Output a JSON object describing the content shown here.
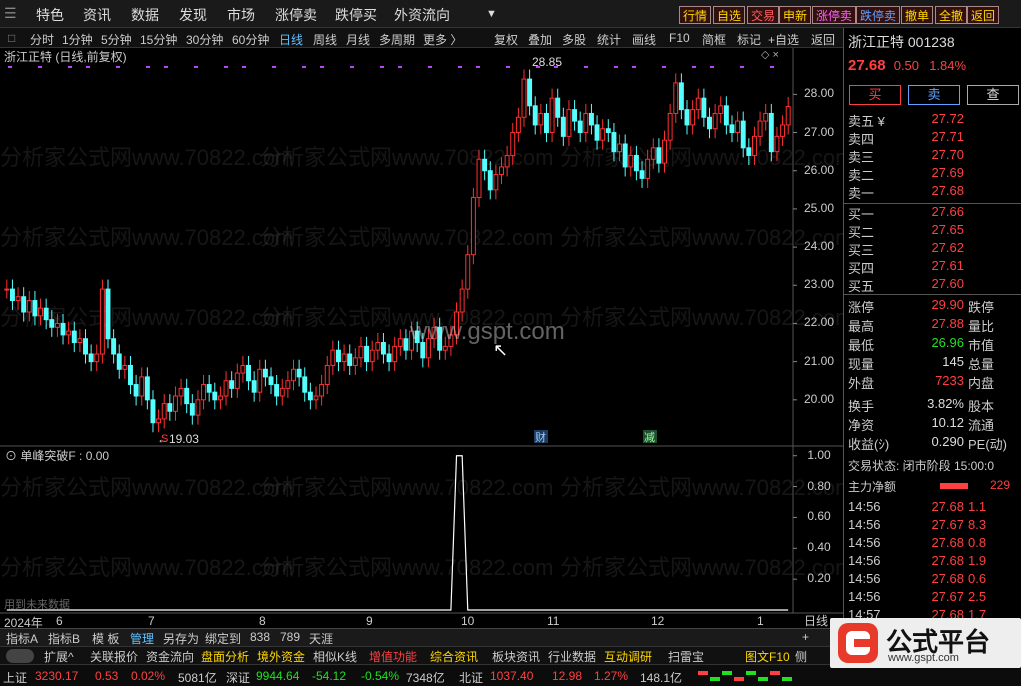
{
  "menubar": {
    "items": [
      "特色",
      "资讯",
      "数据",
      "发现",
      "市场",
      "涨停卖",
      "跌停买",
      "外资流向"
    ],
    "quick": [
      {
        "label": "行情",
        "color": "#ffd700"
      },
      {
        "label": "自选",
        "color": "#ffd700"
      },
      {
        "label": "交易",
        "color": "#ff6060"
      },
      {
        "label": "申新",
        "color": "#ffd700"
      },
      {
        "label": "涨停卖",
        "color": "#ff60ff"
      },
      {
        "label": "跌停卖",
        "color": "#60a0ff"
      },
      {
        "label": "撤单",
        "color": "#ffd700"
      },
      {
        "label": "全撤",
        "color": "#ffd700"
      },
      {
        "label": "返回",
        "color": "#ffd700"
      }
    ]
  },
  "periods": [
    "分时",
    "1分钟",
    "5分钟",
    "15分钟",
    "30分钟",
    "60分钟",
    "日线",
    "周线",
    "月线",
    "多周期",
    "更多 〉"
  ],
  "active_period": "日线",
  "tools": [
    "复权",
    "叠加",
    "多股",
    "统计",
    "画线",
    "F10",
    "简框",
    "标记",
    "+自选",
    "返回"
  ],
  "chart_title": "浙江正特 (日线,前复权)",
  "subchart_title": "单峰突破F : 0.00",
  "subchart_note": "用到未来数据",
  "watermark": "分析家公式网www.70822.com",
  "center_watermark": "www.gspt.com",
  "chart_data": [
    {
      "type": "candlestick",
      "ylim": [
        19.0,
        28.9
      ],
      "yticks": [
        "28.00",
        "27.00",
        "26.00",
        "25.00",
        "24.00",
        "23.00",
        "22.00",
        "21.00",
        "20.00"
      ],
      "ytick_values": [
        28,
        27,
        26,
        25,
        24,
        23,
        22,
        21,
        20
      ],
      "xticks": [
        "2024年",
        "6",
        "7",
        "8",
        "9",
        "10",
        "11",
        "12",
        "1"
      ],
      "annotations": [
        {
          "text": "28.85",
          "value": 28.85
        },
        {
          "text": "19.03",
          "value": 19.03
        },
        {
          "text": "S"
        },
        {
          "text": "财"
        },
        {
          "text": "减"
        }
      ],
      "close": [
        22.9,
        22.6,
        22.7,
        22.3,
        22.6,
        22.2,
        22.4,
        22.1,
        21.9,
        22.0,
        21.7,
        21.8,
        21.5,
        21.6,
        21.2,
        21.0,
        21.2,
        22.9,
        21.6,
        21.2,
        20.8,
        20.9,
        20.4,
        20.1,
        20.6,
        20.0,
        19.4,
        19.5,
        19.9,
        19.7,
        20.1,
        20.3,
        19.9,
        19.6,
        20.0,
        20.4,
        20.2,
        20.0,
        20.1,
        20.5,
        20.3,
        20.7,
        20.9,
        20.5,
        20.2,
        20.8,
        20.6,
        20.4,
        20.1,
        20.3,
        20.5,
        20.8,
        20.6,
        20.2,
        20.0,
        20.1,
        20.4,
        20.9,
        21.3,
        21.0,
        21.2,
        20.9,
        21.1,
        21.4,
        21.0,
        21.3,
        21.5,
        21.2,
        21.0,
        21.4,
        21.6,
        21.3,
        21.8,
        21.5,
        21.1,
        21.6,
        21.9,
        21.3,
        21.4,
        21.7,
        22.3,
        22.9,
        23.8,
        25.3,
        26.3,
        26.0,
        25.5,
        25.9,
        26.1,
        26.4,
        27.0,
        27.4,
        28.4,
        27.7,
        27.2,
        27.5,
        27.0,
        27.9,
        27.4,
        26.9,
        27.6,
        27.3,
        27.0,
        27.5,
        27.2,
        26.8,
        27.1,
        27.0,
        26.5,
        26.7,
        26.1,
        26.4,
        26.0,
        25.8,
        26.3,
        26.6,
        26.2,
        26.8,
        27.5,
        28.3,
        27.6,
        27.2,
        27.6,
        27.9,
        27.4,
        27.1,
        27.5,
        27.7,
        27.2,
        27.0,
        27.3,
        26.6,
        26.4,
        26.9,
        27.3,
        27.5,
        26.5,
        26.9,
        27.2,
        27.68
      ],
      "indicator": {
        "name": "单峰突破F",
        "yticks": [
          "1.00",
          "0.80",
          "0.60",
          "0.40",
          "0.20"
        ],
        "ytick_values": [
          1,
          0.8,
          0.6,
          0.4,
          0.2
        ],
        "ylim": [
          0,
          1.05
        ],
        "spikes": [
          {
            "index": 80,
            "value": 1.0
          },
          {
            "index": 81,
            "value": 1.0
          }
        ]
      }
    }
  ],
  "quote": {
    "name": "浙江正特",
    "code": "001238",
    "price": "27.68",
    "change": "0.50",
    "pct": "1.84%",
    "buttons": [
      "买",
      "卖",
      "查"
    ],
    "asks": [
      {
        "label": "卖五 ¥",
        "price": "27.72"
      },
      {
        "label": "卖四",
        "price": "27.71"
      },
      {
        "label": "卖三",
        "price": "27.70"
      },
      {
        "label": "卖二",
        "price": "27.69"
      },
      {
        "label": "卖一",
        "price": "27.68"
      }
    ],
    "bids": [
      {
        "label": "买一",
        "price": "27.66"
      },
      {
        "label": "买二",
        "price": "27.65"
      },
      {
        "label": "买三",
        "price": "27.62"
      },
      {
        "label": "买四",
        "price": "27.61"
      },
      {
        "label": "买五",
        "price": "27.60"
      }
    ],
    "stats": [
      {
        "l": "涨停",
        "v": "29.90",
        "r": "跌停",
        "c": "red"
      },
      {
        "l": "最高",
        "v": "27.88",
        "r": "量比",
        "c": "red"
      },
      {
        "l": "最低",
        "v": "26.96",
        "r": "市值",
        "c": "green"
      },
      {
        "l": "现量",
        "v": "145",
        "r": "总量",
        "c": "white"
      },
      {
        "l": "外盘",
        "v": "7233",
        "r": "内盘",
        "c": "red"
      },
      {
        "l": "换手",
        "v": "3.82%",
        "r": "股本",
        "c": "white"
      },
      {
        "l": "净资",
        "v": "10.12",
        "r": "流通",
        "c": "white"
      },
      {
        "l": "收益(ｼ)",
        "v": "0.290",
        "r": "PE(动)",
        "c": "white"
      }
    ],
    "trade_state": "交易状态: 闭市阶段 15:00:0",
    "main_flow_label": "主力净额",
    "main_flow_value": "229",
    "ticks": [
      {
        "t": "14:56",
        "p": "27.68",
        "q": "1.1"
      },
      {
        "t": "14:56",
        "p": "27.67",
        "q": "8.3"
      },
      {
        "t": "14:56",
        "p": "27.68",
        "q": "0.8"
      },
      {
        "t": "14:56",
        "p": "27.68",
        "q": "1.9"
      },
      {
        "t": "14:56",
        "p": "27.68",
        "q": "0.6"
      },
      {
        "t": "14:56",
        "p": "27.67",
        "q": "2.5"
      },
      {
        "t": "14:57",
        "p": "27.68",
        "q": "1.7"
      }
    ]
  },
  "tabs": [
    "指标A",
    "指标B",
    "模 板",
    "管理",
    "另存为",
    "绑定到",
    "838",
    "789",
    "天涯"
  ],
  "funcbar": [
    {
      "label": "扩展^",
      "c": "#ccc"
    },
    {
      "label": "关联报价",
      "c": "#ccc"
    },
    {
      "label": "资金流向",
      "c": "#ccc"
    },
    {
      "label": "盘面分析",
      "c": "#ffd700"
    },
    {
      "label": "境外资金",
      "c": "#ffd700"
    },
    {
      "label": "相似K线",
      "c": "#ccc"
    },
    {
      "label": "增值功能",
      "c": "#ff4040"
    },
    {
      "label": "综合资讯",
      "c": "#ffd700"
    },
    {
      "label": "板块资讯",
      "c": "#ccc"
    },
    {
      "label": "行业数据",
      "c": "#ccc"
    },
    {
      "label": "互动调研",
      "c": "#ffd700"
    },
    {
      "label": "扫雷宝",
      "c": "#ccc"
    },
    {
      "label": "图文F10",
      "c": "#ffd700"
    },
    {
      "label": "侧",
      "c": "#ccc"
    }
  ],
  "status": [
    {
      "t": "上证",
      "c": "#ccc"
    },
    {
      "t": "3230.17",
      "c": "#ff4040"
    },
    {
      "t": "0.53",
      "c": "#ff4040"
    },
    {
      "t": "0.02%",
      "c": "#ff4040"
    },
    {
      "t": "5081亿",
      "c": "#ccc"
    },
    {
      "t": "深证",
      "c": "#ccc"
    },
    {
      "t": "9944.64",
      "c": "#20e020"
    },
    {
      "t": "-54.12",
      "c": "#20e020"
    },
    {
      "t": "-0.54%",
      "c": "#20e020"
    },
    {
      "t": "7348亿",
      "c": "#ccc"
    },
    {
      "t": "北证",
      "c": "#ccc"
    },
    {
      "t": "1037.40",
      "c": "#ff4040"
    },
    {
      "t": "12.98",
      "c": "#ff4040"
    },
    {
      "t": "1.27%",
      "c": "#ff4040"
    },
    {
      "t": "148.1亿",
      "c": "#ccc"
    }
  ],
  "right_xlabel": "日线",
  "logo": {
    "text": "公式平台",
    "url": "www.gspt.com"
  },
  "colors": {
    "up": "#ff3030",
    "down": "#54ffff",
    "indicator": "#ffffff"
  }
}
